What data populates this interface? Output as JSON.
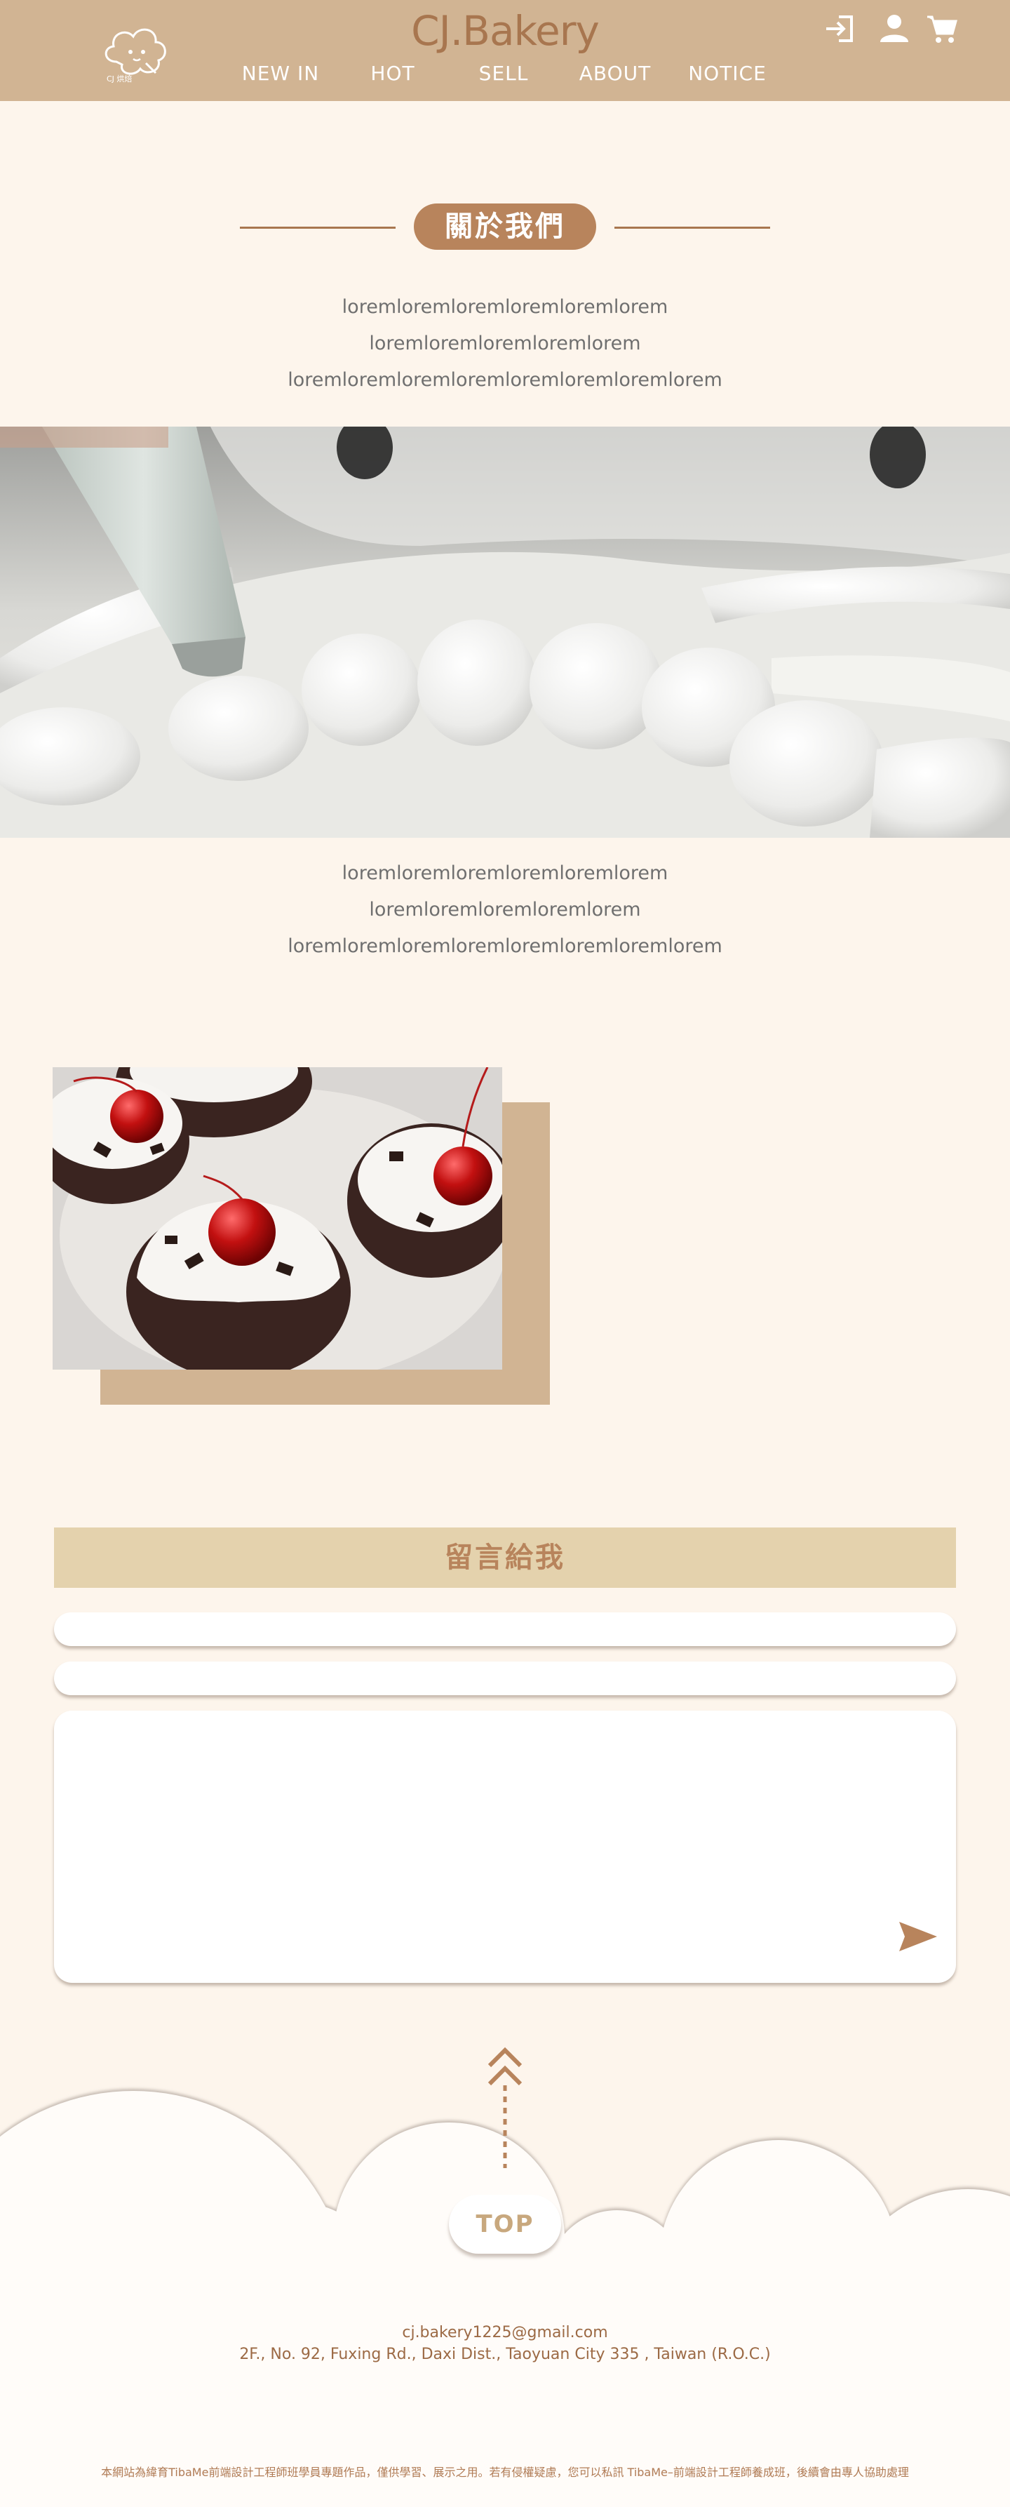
{
  "header": {
    "brand": "CJ.Bakery",
    "nav": [
      "NEW IN",
      "HOT",
      "SELL",
      "ABOUT",
      "NOTICE"
    ],
    "icons": [
      "login-icon",
      "user-icon",
      "cart-icon"
    ],
    "colors": {
      "bar": "#d1b493",
      "brand": "#a8764f"
    }
  },
  "about": {
    "title": "關於我們",
    "lines_top": [
      "loremloremloremloremloremlorem",
      "loremloremloremloremlorem",
      "loremloremloremloremloremloremloremlorem"
    ],
    "lines_bottom": [
      "loremloremloremloremloremlorem",
      "loremloremloremloremlorem",
      "loremloremloremloremloremloremloremlorem"
    ]
  },
  "message": {
    "title": "留言給我",
    "name_value": "",
    "email_value": "",
    "message_value": ""
  },
  "footer": {
    "top_label": "TOP",
    "email": "cj.bakery1225@gmail.com",
    "address": "2F., No. 92, Fuxing Rd., Daxi Dist., Taoyuan City 335 , Taiwan (R.O.C.)",
    "disclaimer": "本網站為緯育TibaMe前端設計工程師班學員專題作品，僅供學習、展示之用。若有侵權疑慮，您可以私訊 TibaMe–前端設計工程師養成班，後續會由專人協助處理"
  }
}
